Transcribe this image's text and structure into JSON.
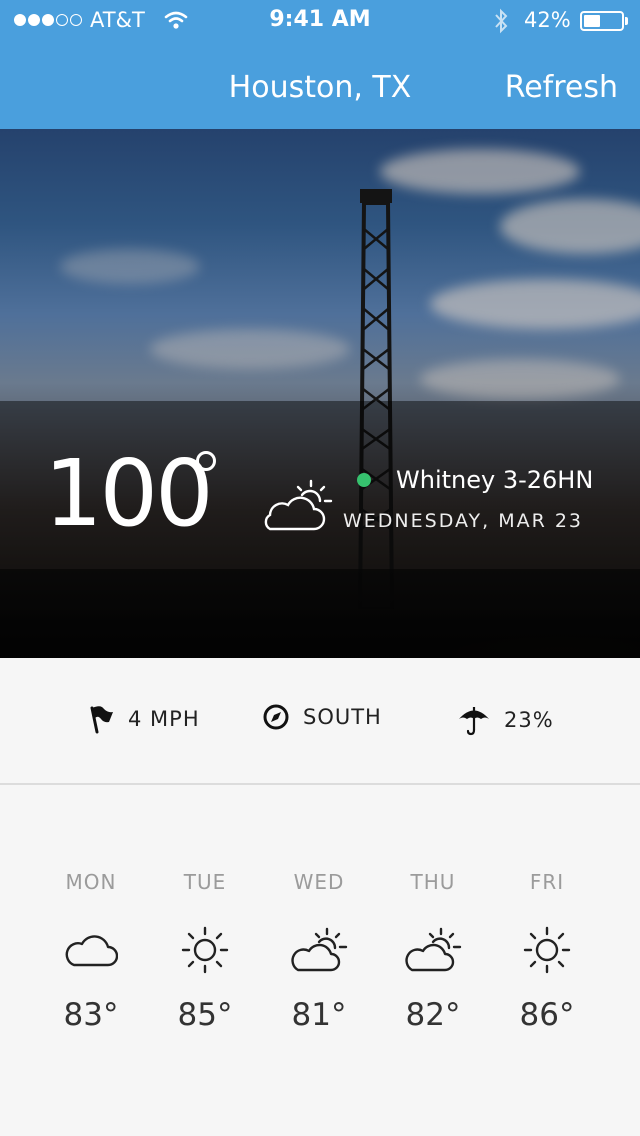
{
  "status_bar": {
    "carrier": "AT&T",
    "time": "9:41 AM",
    "battery": "42%",
    "signal_bars_filled": 3,
    "battery_level": 0.42
  },
  "nav": {
    "title": "Houston, TX",
    "refresh_label": "Refresh"
  },
  "current": {
    "temperature": "100",
    "icon": "partly-cloudy-icon",
    "well_name": "Whitney 3-26HN",
    "well_status_color": "#36c16e",
    "date": "WEDNESDAY, MAR 23"
  },
  "conditions": {
    "wind_speed": "4 MPH",
    "wind_direction": "SOUTH",
    "precipitation": "23%"
  },
  "forecast": [
    {
      "day": "MON",
      "icon": "cloud-icon",
      "temp": "83°"
    },
    {
      "day": "TUE",
      "icon": "sun-icon",
      "temp": "85°"
    },
    {
      "day": "WED",
      "icon": "partly-cloudy-icon",
      "temp": "81°"
    },
    {
      "day": "THU",
      "icon": "partly-cloudy-icon",
      "temp": "82°"
    },
    {
      "day": "FRI",
      "icon": "sun-icon",
      "temp": "86°"
    }
  ],
  "colors": {
    "header": "#4a9fdd",
    "background": "#f6f6f6"
  }
}
